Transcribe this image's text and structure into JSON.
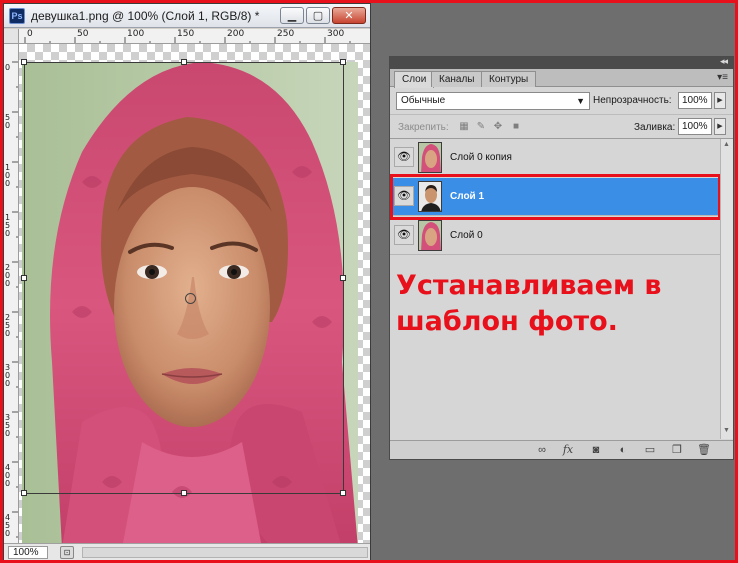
{
  "document": {
    "app_icon": "Ps",
    "title": "девушка1.png @ 100% (Слой 1, RGB/8) *",
    "minimize_glyph": "▁",
    "maximize_glyph": "▢",
    "close_glyph": "✕",
    "ruler_top_labels": [
      "0",
      "50",
      "100",
      "150",
      "200",
      "250",
      "300"
    ],
    "ruler_left_labels": [
      "0",
      "50",
      "100",
      "150",
      "200",
      "250",
      "300",
      "350",
      "400",
      "450"
    ],
    "zoom": "100%"
  },
  "layers_panel": {
    "collapse_glyph": "◂◂",
    "tabs": [
      {
        "label": "Слои",
        "active": true
      },
      {
        "label": "Каналы",
        "active": false
      },
      {
        "label": "Контуры",
        "active": false
      }
    ],
    "panel_menu_glyph": "▾≡",
    "blend_mode": "Обычные",
    "opacity_label": "Непрозрачность:",
    "opacity_value": "100%",
    "lock_label": "Закрепить:",
    "fill_label": "Заливка:",
    "fill_value": "100%",
    "layers": [
      {
        "name": "Слой 0 копия",
        "visible": true,
        "selected": false,
        "thumb": "pink-headscarf-portrait"
      },
      {
        "name": "Слой 1",
        "visible": true,
        "selected": true,
        "thumb": "man-portrait"
      },
      {
        "name": "Слой 0",
        "visible": true,
        "selected": false,
        "thumb": "pink-headscarf-portrait"
      }
    ],
    "bottom_icons": [
      "link-icon",
      "fx-icon",
      "mask-icon",
      "adjustment-icon",
      "group-icon",
      "new-layer-icon",
      "trash-icon"
    ]
  },
  "annotation": {
    "line1": "Устанавливаем в",
    "line2": "шаблон фото.",
    "color": "#e8101a"
  },
  "colors": {
    "accent_red": "#e8101a",
    "selection_blue": "#3b8ee6",
    "scarf_pink": "#d43f73"
  }
}
